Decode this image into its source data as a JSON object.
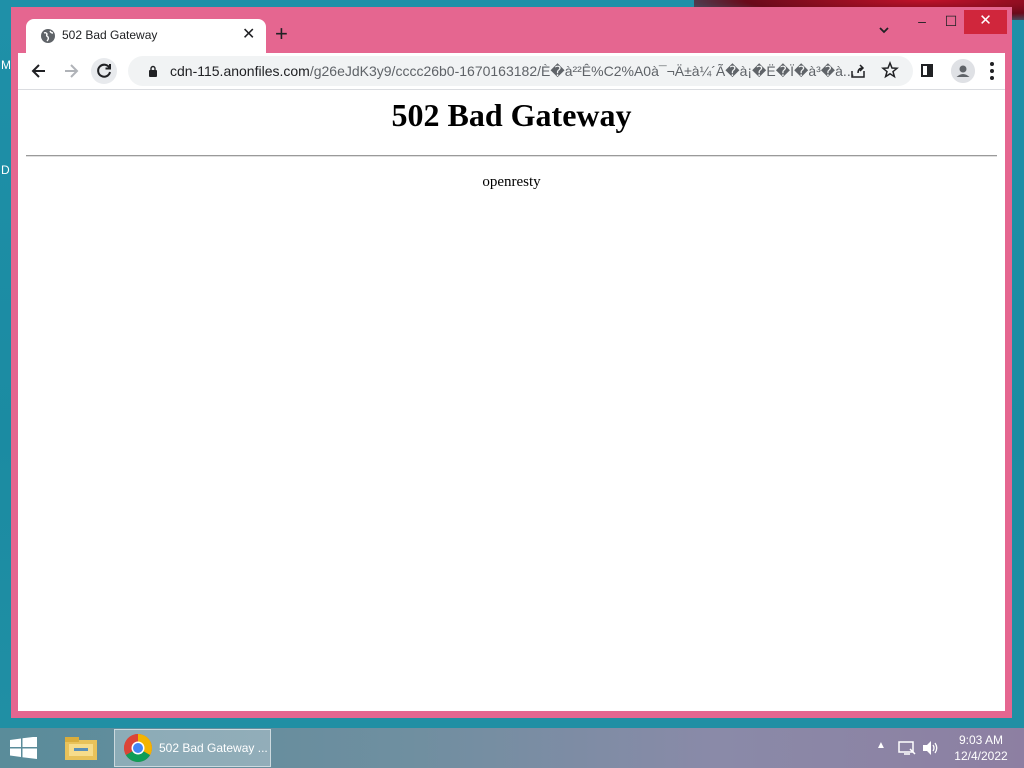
{
  "desktop": {
    "edge_letters": [
      "M",
      "D"
    ]
  },
  "browser": {
    "tab": {
      "title": "502 Bad Gateway",
      "close_label": "✕"
    },
    "new_tab_label": "+",
    "window_controls": {
      "minimize": "–",
      "maximize": "☐",
      "close": "✕"
    },
    "address": {
      "host": "cdn-115.anonfiles.com",
      "path": "/g26eJdK3y9/cccc26b0-1670163182/È�à²²Ê%C2%A0à¯¬Ä±à¼´Ã�à¡�Ë�Ï�à³�à..."
    }
  },
  "page": {
    "heading": "502 Bad Gateway",
    "server": "openresty"
  },
  "taskbar": {
    "task_label": "502 Bad Gateway ...",
    "tray_arrow": "▲",
    "time": "9:03 AM",
    "date": "12/4/2022"
  },
  "colors": {
    "window_frame": "#e56690",
    "close_button": "#d0263c",
    "desktop": "#1f90a8"
  }
}
